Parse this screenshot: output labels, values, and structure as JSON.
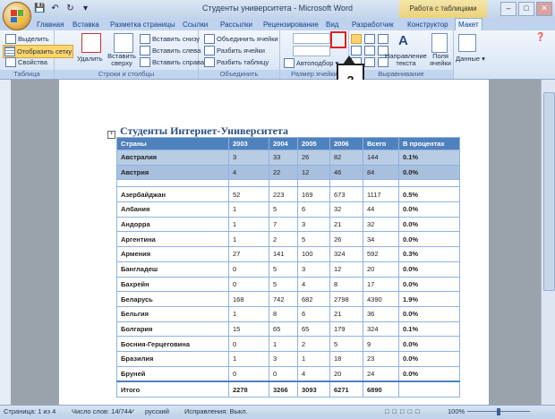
{
  "window": {
    "title": "Студенты университета - Microsoft Word",
    "contextual_title": "Работа с таблицами"
  },
  "tabs": [
    "Главная",
    "Вставка",
    "Разметка страницы",
    "Ссылки",
    "Рассылки",
    "Рецензирование",
    "Вид",
    "Разработчик",
    "Конструктор",
    "Макет"
  ],
  "ribbon": {
    "table_group": {
      "label": "Таблица",
      "select": "Выделить",
      "show_grid": "Отобразить сетку",
      "properties": "Свойства"
    },
    "rows_cols_group": {
      "label": "Строки и столбцы",
      "delete": "Удалить",
      "insert_above": "Вставить сверху",
      "insert_below": "Вставить снизу",
      "insert_left": "Вставить слева",
      "insert_right": "Вставить справа"
    },
    "merge_group": {
      "label": "Объединить",
      "merge_cells": "Объединить ячейки",
      "split_cells": "Разбить ячейки",
      "split_table": "Разбить таблицу"
    },
    "cell_size_group": {
      "label": "Размер ячейки",
      "autofit": "Автоподбор"
    },
    "alignment_group": {
      "label": "Выравнивание",
      "text_direction": "Направление текста",
      "cell_margins": "Поля ячейки"
    },
    "data_group": {
      "label": "Данные"
    }
  },
  "callout": "?",
  "document": {
    "title": "Студенты Интернет-Университета",
    "headers": [
      "Страны",
      "2003",
      "2004",
      "2005",
      "2006",
      "Всего",
      "В процентах"
    ],
    "rows": [
      [
        "Австралия",
        "3",
        "33",
        "26",
        "82",
        "144",
        "0.1%"
      ],
      [
        "Австрия",
        "4",
        "22",
        "12",
        "46",
        "84",
        "0.0%"
      ],
      [
        "Азербайджан",
        "52",
        "223",
        "169",
        "673",
        "1117",
        "0.5%"
      ],
      [
        "Албания",
        "1",
        "5",
        "6",
        "32",
        "44",
        "0.0%"
      ],
      [
        "Андорра",
        "1",
        "7",
        "3",
        "21",
        "32",
        "0.0%"
      ],
      [
        "Аргентина",
        "1",
        "2",
        "5",
        "26",
        "34",
        "0.0%"
      ],
      [
        "Армения",
        "27",
        "141",
        "100",
        "324",
        "592",
        "0.3%"
      ],
      [
        "Бангладеш",
        "0",
        "5",
        "3",
        "12",
        "20",
        "0.0%"
      ],
      [
        "Бахрейн",
        "0",
        "5",
        "4",
        "8",
        "17",
        "0.0%"
      ],
      [
        "Беларусь",
        "168",
        "742",
        "682",
        "2798",
        "4390",
        "1.9%"
      ],
      [
        "Бельгия",
        "1",
        "8",
        "6",
        "21",
        "36",
        "0.0%"
      ],
      [
        "Болгария",
        "15",
        "65",
        "65",
        "179",
        "324",
        "0.1%"
      ],
      [
        "Босния-Герцеговина",
        "0",
        "1",
        "2",
        "5",
        "9",
        "0.0%"
      ],
      [
        "Бразилия",
        "1",
        "3",
        "1",
        "18",
        "23",
        "0.0%"
      ],
      [
        "Бруней",
        "0",
        "0",
        "4",
        "20",
        "24",
        "0.0%"
      ]
    ],
    "total": [
      "Итого",
      "2278",
      "3266",
      "3093",
      "6271",
      "6890",
      ""
    ]
  },
  "status": {
    "page": "Страница: 1 из 4",
    "words": "Число слов: 14/744",
    "language": "русский",
    "track_changes": "Исправления: Выкл.",
    "zoom": "100%"
  }
}
